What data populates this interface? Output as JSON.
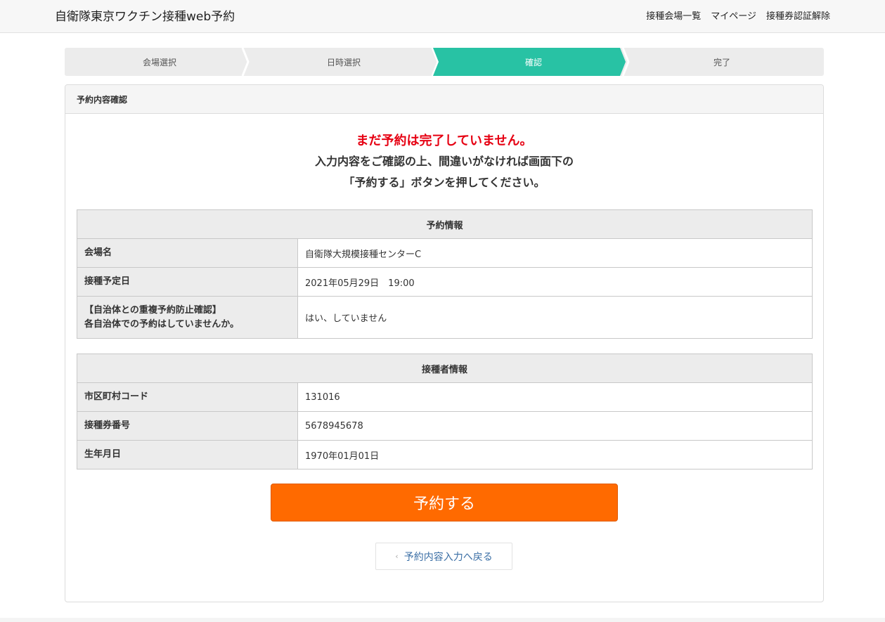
{
  "header": {
    "title": "自衛隊東京ワクチン接種web予約",
    "nav": [
      "接種会場一覧",
      "マイページ",
      "接種券認証解除"
    ]
  },
  "steps": {
    "items": [
      "会場選択",
      "日時選択",
      "確認",
      "完了"
    ],
    "active_index": 2,
    "active_color": "#28c2a4"
  },
  "panel": {
    "title": "予約内容確認",
    "notice": {
      "warning": "まだ予約は完了していません。",
      "line1": "入力内容をご確認の上、間違いがなければ画面下の",
      "line2": "「予約する」ボタンを押してください。"
    },
    "reservation": {
      "caption": "予約情報",
      "rows": [
        {
          "label": "会場名",
          "value": "自衛隊大規模接種センターC"
        },
        {
          "label": "接種予定日",
          "value": "2021年05月29日　19:00"
        },
        {
          "label_line1": "【自治体との重複予約防止確認】",
          "label_line2": "各自治体での予約はしていませんか。",
          "value": "はい、していません"
        }
      ]
    },
    "recipient": {
      "caption": "接種者情報",
      "rows": [
        {
          "label": "市区町村コード",
          "value": "131016"
        },
        {
          "label": "接種券番号",
          "value": "5678945678"
        },
        {
          "label": "生年月日",
          "value": "1970年01月01日"
        }
      ]
    },
    "reserve_button": "予約する",
    "back_button": "予約内容入力へ戻る"
  },
  "colors": {
    "accent": "#28c2a4",
    "reserve": "#ff6a00",
    "warning": "#e60012",
    "link": "#3a6ea5"
  }
}
